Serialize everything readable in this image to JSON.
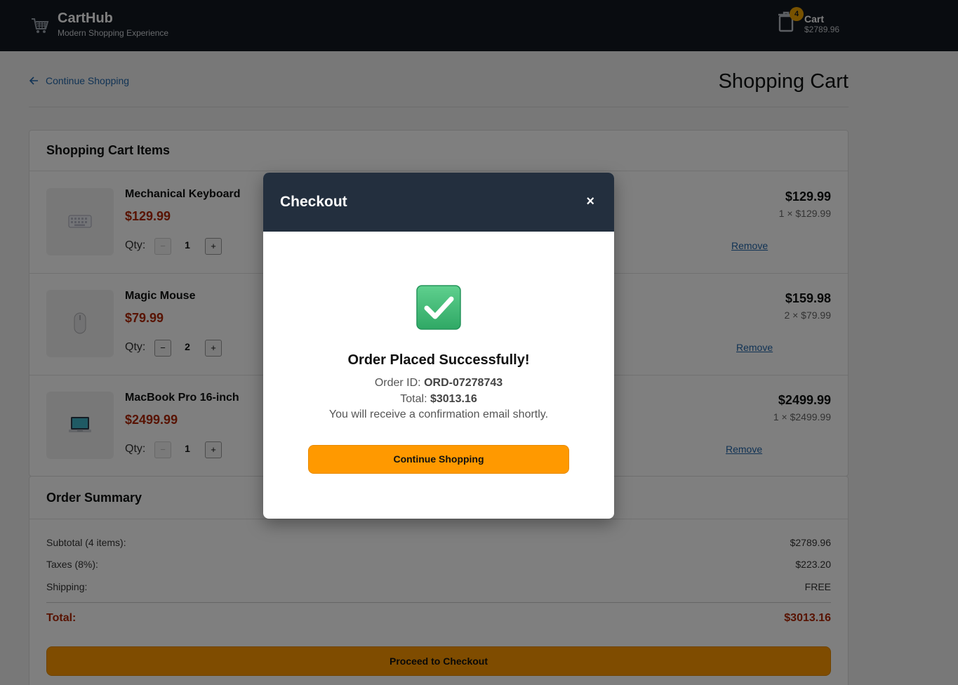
{
  "header": {
    "brand_name": "CartHub",
    "brand_tagline": "Modern Shopping Experience",
    "cart_label": "Cart",
    "cart_total": "$2789.96",
    "cart_count": "4",
    "icons": {
      "logo": "shopping-cart-icon",
      "cart": "trash-bin-icon"
    }
  },
  "page": {
    "back_label": "Continue Shopping",
    "back_icon": "arrow-left-icon",
    "title": "Shopping Cart"
  },
  "cart_items": {
    "heading": "Shopping Cart Items",
    "qty_label": "Qty:",
    "remove_label": "Remove",
    "items": [
      {
        "name": "Mechanical Keyboard",
        "price": "$129.99",
        "qty": "1",
        "line_total": "$129.99",
        "line_detail": "1 × $129.99",
        "image_icon": "keyboard-icon",
        "minus_disabled": true
      },
      {
        "name": "Magic Mouse",
        "price": "$79.99",
        "qty": "2",
        "line_total": "$159.98",
        "line_detail": "2 × $79.99",
        "image_icon": "mouse-icon",
        "minus_disabled": false
      },
      {
        "name": "MacBook Pro 16-inch",
        "price": "$2499.99",
        "qty": "1",
        "line_total": "$2499.99",
        "line_detail": "1 × $2499.99",
        "image_icon": "laptop-icon",
        "minus_disabled": true
      }
    ]
  },
  "summary": {
    "heading": "Order Summary",
    "subtotal_label": "Subtotal (4 items):",
    "subtotal_value": "$2789.96",
    "taxes_label": "Taxes (8%):",
    "taxes_value": "$223.20",
    "shipping_label": "Shipping:",
    "shipping_value": "FREE",
    "total_label": "Total:",
    "total_value": "$3013.16",
    "checkout_label": "Proceed to Checkout"
  },
  "modal": {
    "title": "Checkout",
    "close_glyph": "×",
    "success_icon": "check-mark-icon",
    "success_title": "Order Placed Successfully!",
    "order_id_label": "Order ID:",
    "order_id": "ORD-07278743",
    "total_label": "Total:",
    "total_value": "$3013.16",
    "message": "You will receive a confirmation email shortly.",
    "continue_label": "Continue Shopping"
  },
  "colors": {
    "header_bg": "#131921",
    "accent": "#ff9900",
    "price_red": "#b12704",
    "link_blue": "#2266aa",
    "modal_header": "#232f3e",
    "success_green": "#3cb878"
  }
}
